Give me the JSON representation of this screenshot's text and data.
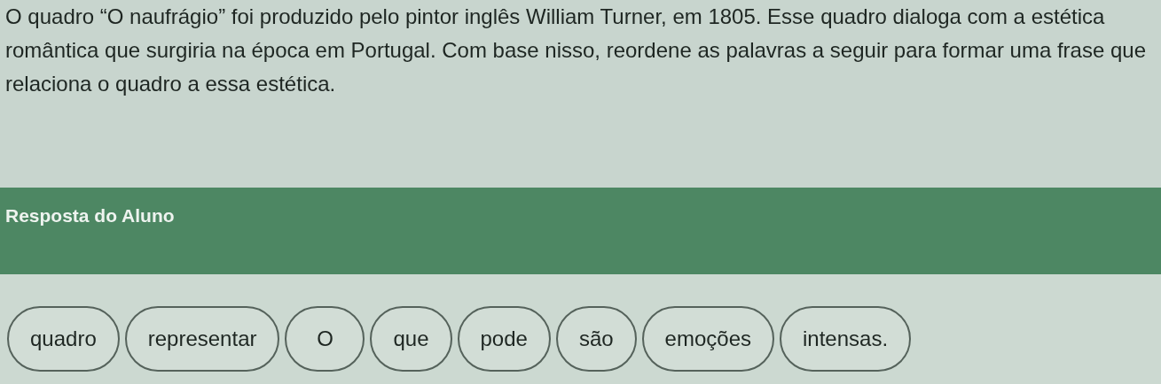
{
  "question": {
    "text": "O quadro “O naufrágio” foi produzido pelo pintor inglês William Turner, em 1805. Esse quadro dialoga com a estética romântica que surgiria na época em Portugal. Com base nisso, reordene as palavras a seguir para formar uma frase que relaciona o quadro a essa estética."
  },
  "answer_header": {
    "title": "Resposta do Aluno"
  },
  "word_chips": [
    {
      "label": "quadro"
    },
    {
      "label": "representar"
    },
    {
      "label": "O"
    },
    {
      "label": "que"
    },
    {
      "label": "pode"
    },
    {
      "label": "são"
    },
    {
      "label": "emoções"
    },
    {
      "label": "intensas."
    }
  ]
}
